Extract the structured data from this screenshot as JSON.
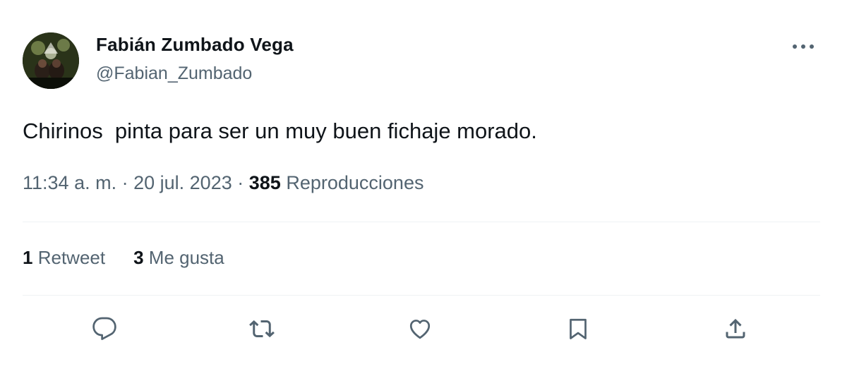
{
  "author": {
    "name": "Fabián Zumbado Vega",
    "handle": "@Fabian_Zumbado"
  },
  "tweet": {
    "text": "Chirinos  pinta para ser un muy buen fichaje morado.",
    "time": "11:34 a. m.",
    "separator": "·",
    "date": "20 jul. 2023",
    "views_count": "385",
    "views_label": "Reproducciones"
  },
  "stats": {
    "retweets_count": "1",
    "retweets_label": "Retweet",
    "likes_count": "3",
    "likes_label": "Me gusta"
  },
  "actions": [
    {
      "icon": "reply-icon"
    },
    {
      "icon": "retweet-icon"
    },
    {
      "icon": "like-icon"
    },
    {
      "icon": "bookmark-icon"
    },
    {
      "icon": "share-icon"
    }
  ],
  "colors": {
    "text_primary": "#0f1419",
    "text_secondary": "#536471",
    "divider": "#eff3f4"
  }
}
